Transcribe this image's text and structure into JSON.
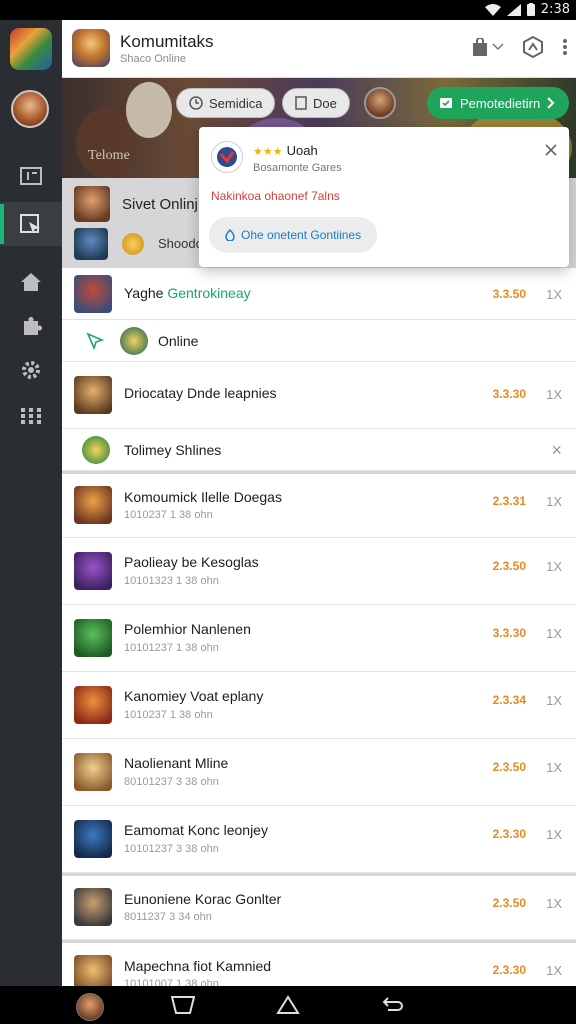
{
  "status_bar": {
    "time": "2:38"
  },
  "app": {
    "title": "Komumitaks",
    "subtitle": "Shaco Online"
  },
  "banner": {
    "label": "Telome",
    "chips": [
      {
        "label": "Semidica",
        "icon": "clock-icon"
      },
      {
        "label": "Doe",
        "icon": "doc-icon"
      }
    ],
    "primary_button": "Pemotedietirn"
  },
  "status_panel": {
    "title": "Sivet Onlinj",
    "subtitle": "Shoodo"
  },
  "popup": {
    "stars": "★★★",
    "title": "Uoah",
    "subtitle": "Bosamonte Gares",
    "warning": "Nakinkoa ohaonef 7alns",
    "pill_label": "Ohe onetent Gontiines"
  },
  "rows": [
    {
      "kind": "game",
      "title_plain": "Yaghe",
      "title_green": "Gentrokineay",
      "value": "3.3.50",
      "close": "1X",
      "thumb": [
        "#3a4d7a",
        "#c04a3a"
      ]
    },
    {
      "kind": "sub",
      "label": "Online",
      "has_coin": true
    },
    {
      "kind": "game",
      "title_plain": "Driocatay Dnde leapnies",
      "value": "3.3.30",
      "close": "1X",
      "thumb": [
        "#e7b06e",
        "#5a3a20"
      ]
    },
    {
      "kind": "sub_close",
      "label": "Tolimey Shlines",
      "close": "×"
    },
    {
      "kind": "game",
      "title_plain": "Komoumick Ilelle Doegas",
      "subtitle": "1010237 1 38 ohn",
      "value": "2.3.31",
      "close": "1X",
      "thumb": [
        "#f0a04a",
        "#6c3620"
      ]
    },
    {
      "kind": "game",
      "title_plain": "Paolieay be Kesoglas",
      "subtitle": "10101323 1 38 ohn",
      "value": "2.3.50",
      "close": "1X",
      "thumb": [
        "#9a53c9",
        "#3b2160"
      ]
    },
    {
      "kind": "game",
      "title_plain": "Polemhior Nanlenen",
      "subtitle": "10101237 1 38 ohn",
      "value": "3.3.30",
      "close": "1X",
      "thumb": [
        "#5ac05a",
        "#1f5a25"
      ]
    },
    {
      "kind": "game",
      "title_plain": "Kanomiey Voat eplany",
      "subtitle": "1010237 1 38 ohn",
      "value": "2.3.34",
      "close": "1X",
      "thumb": [
        "#f0903a",
        "#8a2a18"
      ]
    },
    {
      "kind": "game",
      "title_plain": "Naolienant Mline",
      "subtitle": "80101237 3 38 ohn",
      "value": "2.3.50",
      "close": "1X",
      "thumb": [
        "#f0d090",
        "#8a5a2a"
      ]
    },
    {
      "kind": "game",
      "title_plain": "Eamomat Konc leonjey",
      "subtitle": "10101237 3 38 ohn",
      "value": "2.3.30",
      "close": "1X",
      "thumb": [
        "#3a7ac0",
        "#152a4a"
      ]
    },
    {
      "kind": "game",
      "title_plain": "Eunoniene Korac Gonlter",
      "subtitle": "8011237 3 34 ohn",
      "value": "2.3.50",
      "close": "1X",
      "thumb": [
        "#c8a070",
        "#3a3a3a"
      ]
    },
    {
      "kind": "game",
      "title_plain": "Mapechna fiot Kamnied",
      "subtitle": "10101007 1 38 ohn",
      "value": "2.3.30",
      "close": "1X",
      "thumb": [
        "#f0c070",
        "#7a4a2a"
      ]
    }
  ],
  "colors": {
    "accent_green": "#1fa55b",
    "value_orange": "#e68a1f",
    "warning_red": "#d0433a",
    "rail_bg": "#2a2d31"
  }
}
